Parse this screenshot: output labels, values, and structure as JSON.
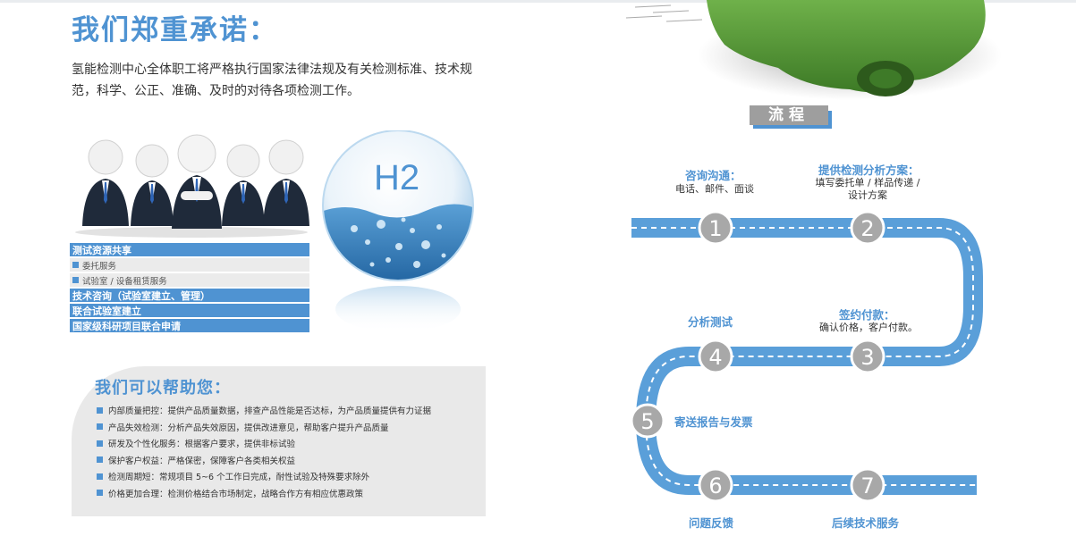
{
  "promise": {
    "title": "我们郑重承诺：",
    "text": "氢能检测中心全体职工将严格执行国家法律法规及有关检测标准、技术规范，科学、公正、准确、及时的对待各项检测工作。"
  },
  "h2_label": "H2",
  "services": [
    {
      "label": "测试资源共享",
      "kind": "main"
    },
    {
      "label": "委托服务",
      "kind": "sub"
    },
    {
      "label": "试验室 / 设备租赁服务",
      "kind": "sub"
    },
    {
      "label": "技术咨询（试验室建立、管理）",
      "kind": "main"
    },
    {
      "label": "联合试验室建立",
      "kind": "main"
    },
    {
      "label": "国家级科研项目联合申请",
      "kind": "main"
    }
  ],
  "help": {
    "title": "我们可以帮助您：",
    "items": [
      "内部质量把控：提供产品质量数据，排查产品性能是否达标，为产品质量提供有力证据",
      "产品失效检测：分析产品失效原因，提供改进意见，帮助客户提升产品质量",
      "研发及个性化服务：根据客户要求，提供非标试验",
      "保护客户权益：严格保密，保障客户各类相关权益",
      "检测周期短：常规项目 5~6 个工作日完成，耐性试验及特殊要求除外",
      "价格更加合理：检测价格结合市场制定，战略合作方有相应优惠政策"
    ]
  },
  "process": {
    "title": "流程",
    "steps": [
      {
        "num": "1",
        "label": "咨询沟通：",
        "desc": "电话、邮件、面谈"
      },
      {
        "num": "2",
        "label": "提供检测分析方案：",
        "desc": "填写委托单 / 样品传递 / 设计方案"
      },
      {
        "num": "3",
        "label": "签约付款：",
        "desc": "确认价格，客户付款。"
      },
      {
        "num": "4",
        "label": "分析测试",
        "desc": ""
      },
      {
        "num": "5",
        "label": "寄送报告与发票",
        "desc": ""
      },
      {
        "num": "6",
        "label": "问题反馈",
        "desc": ""
      },
      {
        "num": "7",
        "label": "后续技术服务",
        "desc": ""
      }
    ]
  },
  "colors": {
    "accent": "#4f93d2",
    "grey_panel": "#e9e9e9",
    "badge_grey": "#9e9e9e",
    "step_circle": "#a8a8a8",
    "car_green": "#5a9a3a"
  }
}
